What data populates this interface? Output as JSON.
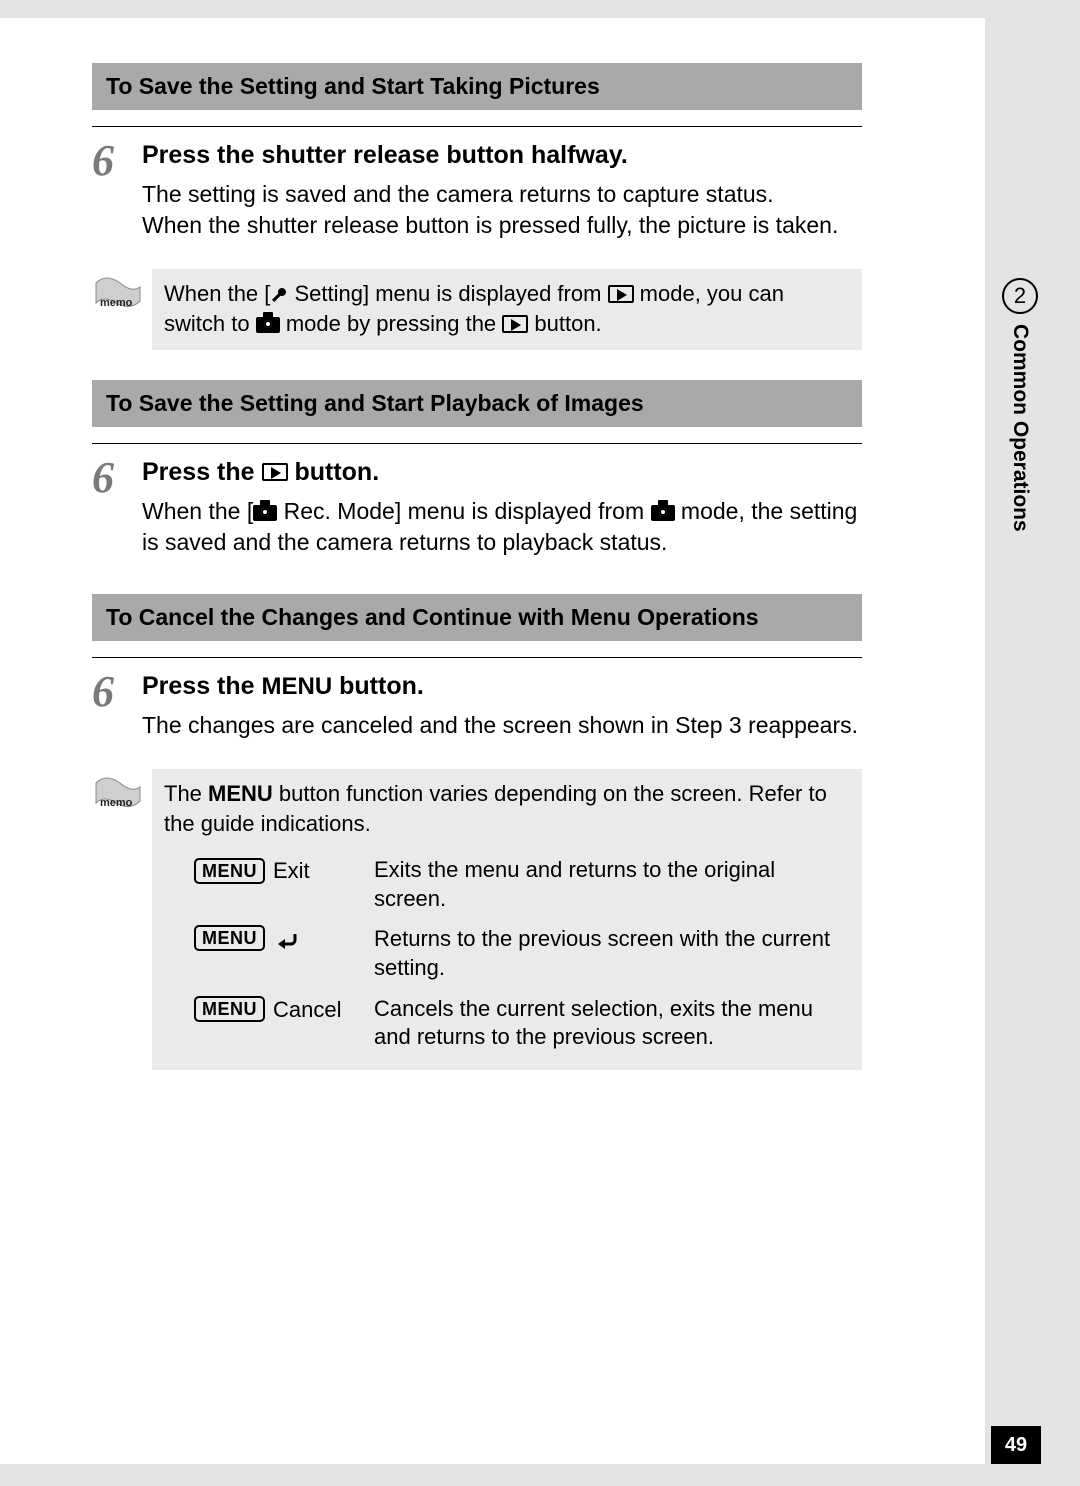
{
  "side": {
    "chapter_number": "2",
    "chapter_title": "Common Operations",
    "page_number": "49"
  },
  "memo_label": "memo",
  "section1": {
    "heading": "To Save the Setting and Start Taking Pictures",
    "step_number": "6",
    "step_title": "Press the shutter release button halfway.",
    "body_line1": "The setting is saved and the camera returns to capture status.",
    "body_line2": "When the shutter release button is pressed fully, the picture is taken.",
    "memo_pre": "When the [",
    "memo_mid1": " Setting] menu is displayed from ",
    "memo_mid2": " mode, you can switch to ",
    "memo_mid3": " mode by pressing the ",
    "memo_end": " button."
  },
  "section2": {
    "heading": "To Save the Setting and Start Playback of Images",
    "step_number": "6",
    "step_title_pre": "Press the ",
    "step_title_post": " button.",
    "body_pre": "When the [",
    "body_mid1": " Rec. Mode] menu is displayed from ",
    "body_mid2": " mode, the setting is saved and the camera returns to playback status."
  },
  "section3": {
    "heading": "To Cancel the Changes and Continue with Menu Operations",
    "step_number": "6",
    "step_title_pre": "Press the ",
    "step_title_menu": "MENU",
    "step_title_post": " button.",
    "body": "The changes are canceled and the screen shown in Step 3 reappears.",
    "memo_intro_pre": "The ",
    "memo_intro_menu": "MENU",
    "memo_intro_post": " button function varies depending on the screen. Refer to the guide indications.",
    "menu_btn_label": "MENU",
    "row1": {
      "label": "Exit",
      "desc": "Exits the menu and returns to the original screen."
    },
    "row2": {
      "desc": "Returns to the previous screen with the current setting."
    },
    "row3": {
      "label": "Cancel",
      "desc": "Cancels the current selection, exits the menu and returns to the previous screen."
    }
  }
}
